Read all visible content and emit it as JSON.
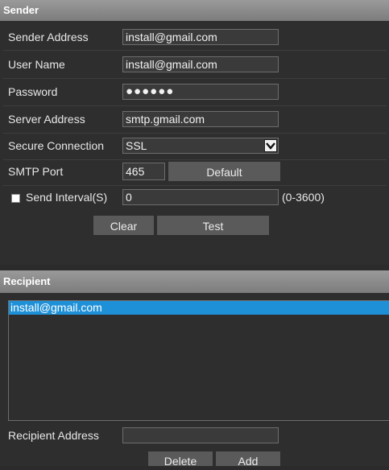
{
  "sender": {
    "title": "Sender",
    "sender_address": {
      "label": "Sender Address",
      "value": "install@gmail.com"
    },
    "user_name": {
      "label": "User Name",
      "value": "install@gmail.com"
    },
    "password": {
      "label": "Password",
      "value": "●●●●●●"
    },
    "server_address": {
      "label": "Server Address",
      "value": "smtp.gmail.com"
    },
    "secure_connection": {
      "label": "Secure Connection",
      "value": "SSL"
    },
    "smtp_port": {
      "label": "SMTP Port",
      "value": "465",
      "default_label": "Default"
    },
    "send_interval": {
      "label": "Send Interval(S)",
      "value": "0",
      "range": "(0-3600)",
      "checked": false
    },
    "clear_label": "Clear",
    "test_label": "Test"
  },
  "recipient": {
    "title": "Recipient",
    "items": [
      "install@gmail.com"
    ],
    "address_label": "Recipient Address",
    "address_value": "",
    "delete_label": "Delete",
    "add_label": "Add"
  }
}
